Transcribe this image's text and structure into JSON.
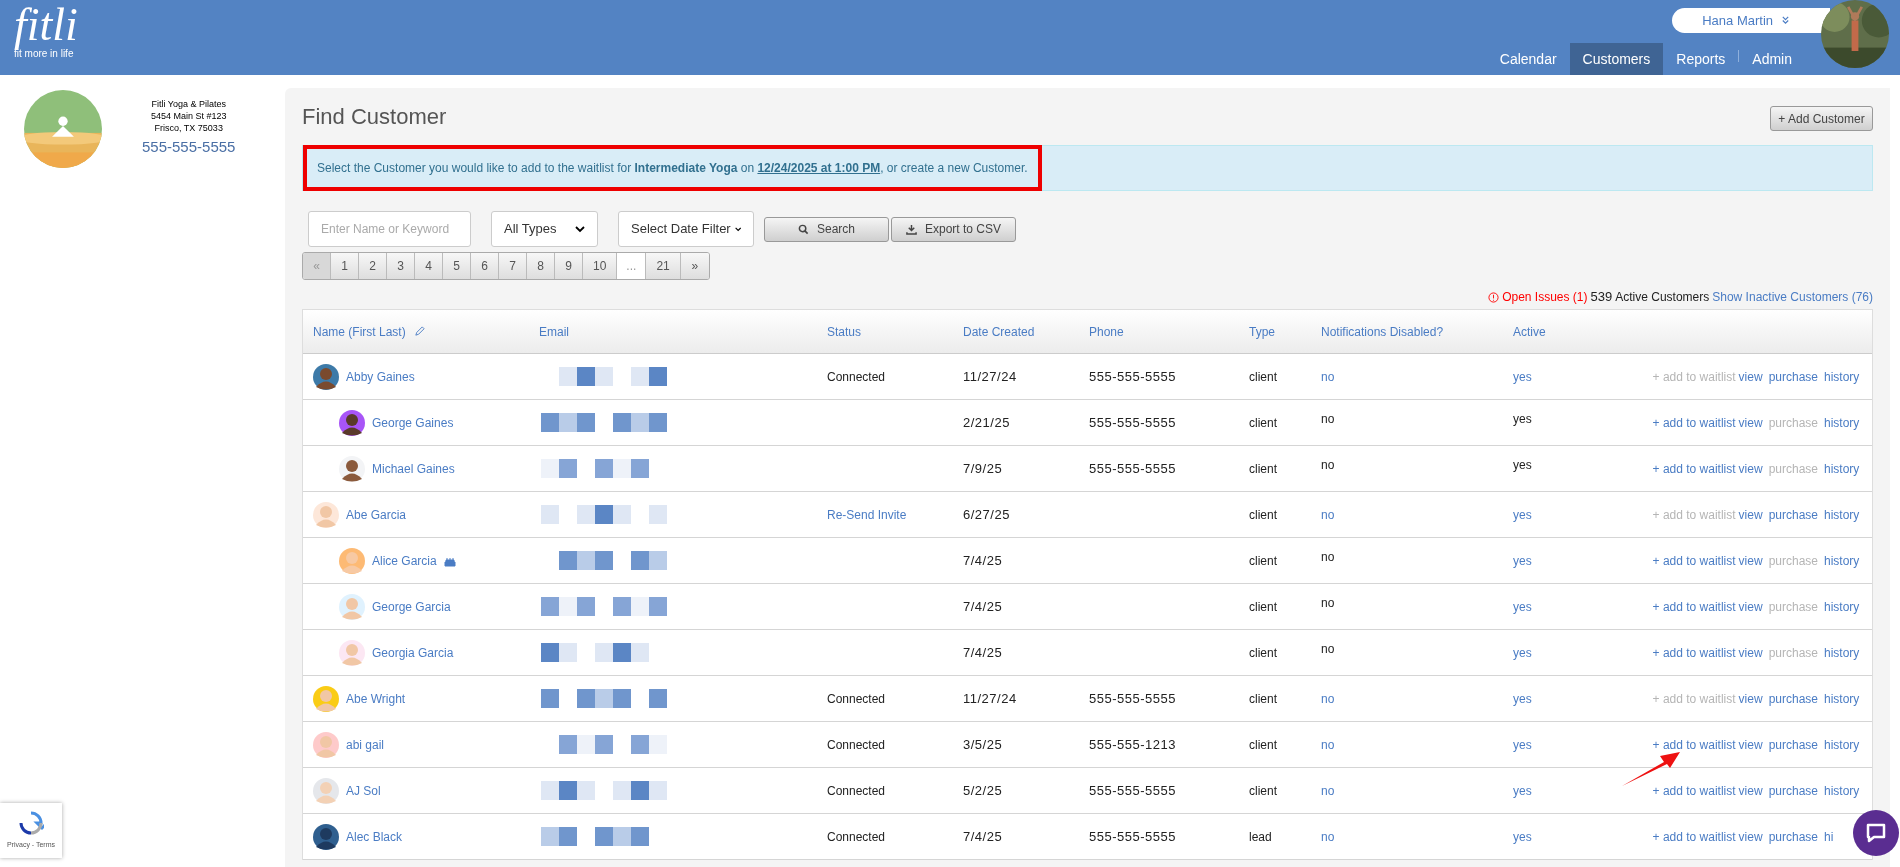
{
  "header": {
    "logo": {
      "name": "fitli",
      "tagline": "fit more in life"
    },
    "user": {
      "name": "Hana Martin"
    },
    "nav": [
      {
        "label": "Calendar",
        "selected": false
      },
      {
        "label": "Customers",
        "selected": true
      },
      {
        "label": "Reports",
        "selected": false
      },
      {
        "label": "Admin",
        "selected": false
      }
    ]
  },
  "studio": {
    "name": "Fitli Yoga & Pilates",
    "address_lines": [
      "5454 Main St #123",
      "Frisco, TX 75033"
    ],
    "phone": "555-555-5555"
  },
  "page": {
    "title": "Find Customer",
    "add_button": "+ Add Customer"
  },
  "notice": {
    "before": "Select the Customer you would like to add to the waitlist for ",
    "class_name": "Intermediate Yoga",
    "middle": " on ",
    "when": "12/24/2025 at 1:00 PM",
    "after": ", or create a new Customer."
  },
  "filters": {
    "search_placeholder": "Enter Name or Keyword",
    "type_select": "All Types",
    "date_select": "Select Date Filter",
    "search_button": "Search",
    "export_button": "Export to CSV"
  },
  "pagination": [
    {
      "label": "«",
      "kind": "nav",
      "disabled": true
    },
    {
      "label": "1",
      "kind": "page",
      "disabled": false
    },
    {
      "label": "2",
      "kind": "page",
      "disabled": false
    },
    {
      "label": "3",
      "kind": "page",
      "disabled": false
    },
    {
      "label": "4",
      "kind": "page",
      "disabled": false
    },
    {
      "label": "5",
      "kind": "page",
      "disabled": false
    },
    {
      "label": "6",
      "kind": "page",
      "disabled": false
    },
    {
      "label": "7",
      "kind": "page",
      "disabled": false
    },
    {
      "label": "8",
      "kind": "page",
      "disabled": false
    },
    {
      "label": "9",
      "kind": "page",
      "disabled": false
    },
    {
      "label": "10",
      "kind": "page",
      "disabled": false
    },
    {
      "label": "...",
      "kind": "gap"
    },
    {
      "label": "21",
      "kind": "page",
      "disabled": false
    },
    {
      "label": "»",
      "kind": "nav",
      "disabled": false
    }
  ],
  "summary": {
    "issues": "Open Issues (1)",
    "count": "539",
    "count_label": "Active Customers",
    "inactive_link": "Show Inactive Customers (76)"
  },
  "table": {
    "columns": [
      "Name (First Last)",
      "Email",
      "Status",
      "Date Created",
      "Phone",
      "Type",
      "Notifications Disabled?",
      "Active"
    ],
    "rows": [
      {
        "name": "Abby Gaines",
        "status": {
          "text": "Connected",
          "kind": "text"
        },
        "date": "11/27/24",
        "phone": "555-555-5555",
        "type": "client",
        "notifications": {
          "text": "no",
          "link": true
        },
        "active": {
          "text": "yes",
          "link": true
        },
        "actions": [
          {
            "label": "+ add to waitlist",
            "disabled": true
          },
          {
            "label": "view",
            "disabled": false
          },
          {
            "label": "purchase",
            "disabled": false
          },
          {
            "label": "history",
            "disabled": false
          }
        ],
        "children": [
          {
            "name": "George Gaines",
            "date": "2/21/25",
            "phone": "555-555-5555",
            "type": "client",
            "notifications": {
              "text": "no",
              "link": false
            },
            "active": {
              "text": "yes",
              "link": false
            },
            "actions": [
              {
                "label": "+ add to waitlist",
                "disabled": false
              },
              {
                "label": "view",
                "disabled": false
              },
              {
                "label": "purchase",
                "disabled": true
              },
              {
                "label": "history",
                "disabled": false
              }
            ]
          },
          {
            "name": "Michael Gaines",
            "date": "7/9/25",
            "phone": "555-555-5555",
            "type": "client",
            "notifications": {
              "text": "no",
              "link": false
            },
            "active": {
              "text": "yes",
              "link": false
            },
            "actions": [
              {
                "label": "+ add to waitlist",
                "disabled": false
              },
              {
                "label": "view",
                "disabled": false
              },
              {
                "label": "purchase",
                "disabled": true
              },
              {
                "label": "history",
                "disabled": false
              }
            ]
          }
        ]
      },
      {
        "name": "Abe Garcia",
        "status": {
          "text": "Re-Send Invite",
          "kind": "link"
        },
        "date": "6/27/25",
        "type": "client",
        "notifications": {
          "text": "no",
          "link": true
        },
        "active": {
          "text": "yes",
          "link": true
        },
        "actions": [
          {
            "label": "+ add to waitlist",
            "disabled": true
          },
          {
            "label": "view",
            "disabled": false
          },
          {
            "label": "purchase",
            "disabled": false
          },
          {
            "label": "history",
            "disabled": false
          }
        ],
        "children": [
          {
            "name": "Alice Garcia",
            "birthday": true,
            "date": "7/4/25",
            "type": "client",
            "notifications": {
              "text": "no",
              "link": false
            },
            "active": {
              "text": "yes",
              "link": true
            },
            "actions": [
              {
                "label": "+ add to waitlist",
                "disabled": false
              },
              {
                "label": "view",
                "disabled": false
              },
              {
                "label": "purchase",
                "disabled": true
              },
              {
                "label": "history",
                "disabled": false
              }
            ]
          },
          {
            "name": "George Garcia",
            "date": "7/4/25",
            "type": "client",
            "notifications": {
              "text": "no",
              "link": false
            },
            "active": {
              "text": "yes",
              "link": true
            },
            "actions": [
              {
                "label": "+ add to waitlist",
                "disabled": false
              },
              {
                "label": "view",
                "disabled": false
              },
              {
                "label": "purchase",
                "disabled": true
              },
              {
                "label": "history",
                "disabled": false
              }
            ]
          },
          {
            "name": "Georgia Garcia",
            "date": "7/4/25",
            "type": "client",
            "notifications": {
              "text": "no",
              "link": false
            },
            "active": {
              "text": "yes",
              "link": true
            },
            "actions": [
              {
                "label": "+ add to waitlist",
                "disabled": false
              },
              {
                "label": "view",
                "disabled": false
              },
              {
                "label": "purchase",
                "disabled": true
              },
              {
                "label": "history",
                "disabled": false
              }
            ]
          }
        ]
      },
      {
        "name": "Abe Wright",
        "status": {
          "text": "Connected",
          "kind": "text"
        },
        "date": "11/27/24",
        "phone": "555-555-5555",
        "type": "client",
        "notifications": {
          "text": "no",
          "link": true
        },
        "active": {
          "text": "yes",
          "link": true
        },
        "actions": [
          {
            "label": "+ add to waitlist",
            "disabled": true
          },
          {
            "label": "view",
            "disabled": false
          },
          {
            "label": "purchase",
            "disabled": false
          },
          {
            "label": "history",
            "disabled": false
          }
        ]
      },
      {
        "name": "abi gail",
        "status": {
          "text": "Connected",
          "kind": "text"
        },
        "date": "3/5/25",
        "phone": "555-555-1213",
        "type": "client",
        "notifications": {
          "text": "no",
          "link": true
        },
        "active": {
          "text": "yes",
          "link": true
        },
        "actions": [
          {
            "label": "+ add to waitlist",
            "disabled": false
          },
          {
            "label": "view",
            "disabled": false
          },
          {
            "label": "purchase",
            "disabled": false
          },
          {
            "label": "history",
            "disabled": false
          }
        ]
      },
      {
        "name": "AJ Sol",
        "status": {
          "text": "Connected",
          "kind": "text"
        },
        "date": "5/2/25",
        "phone": "555-555-5555",
        "type": "client",
        "notifications": {
          "text": "no",
          "link": true
        },
        "active": {
          "text": "yes",
          "link": true
        },
        "actions": [
          {
            "label": "+ add to waitlist",
            "disabled": false
          },
          {
            "label": "view",
            "disabled": false
          },
          {
            "label": "purchase",
            "disabled": false
          },
          {
            "label": "history",
            "disabled": false
          }
        ]
      },
      {
        "name": "Alec Black",
        "status": {
          "text": "Connected",
          "kind": "text"
        },
        "date": "7/4/25",
        "phone": "555-555-5555",
        "type": "lead",
        "notifications": {
          "text": "no",
          "link": true
        },
        "active": {
          "text": "yes",
          "link": true
        },
        "actions": [
          {
            "label": "+ add to waitlist",
            "disabled": false
          },
          {
            "label": "view",
            "disabled": false
          },
          {
            "label": "purchase",
            "disabled": false
          },
          {
            "label": "hi",
            "disabled": false
          }
        ]
      }
    ]
  },
  "recaptcha": {
    "links": "Privacy - Terms"
  }
}
